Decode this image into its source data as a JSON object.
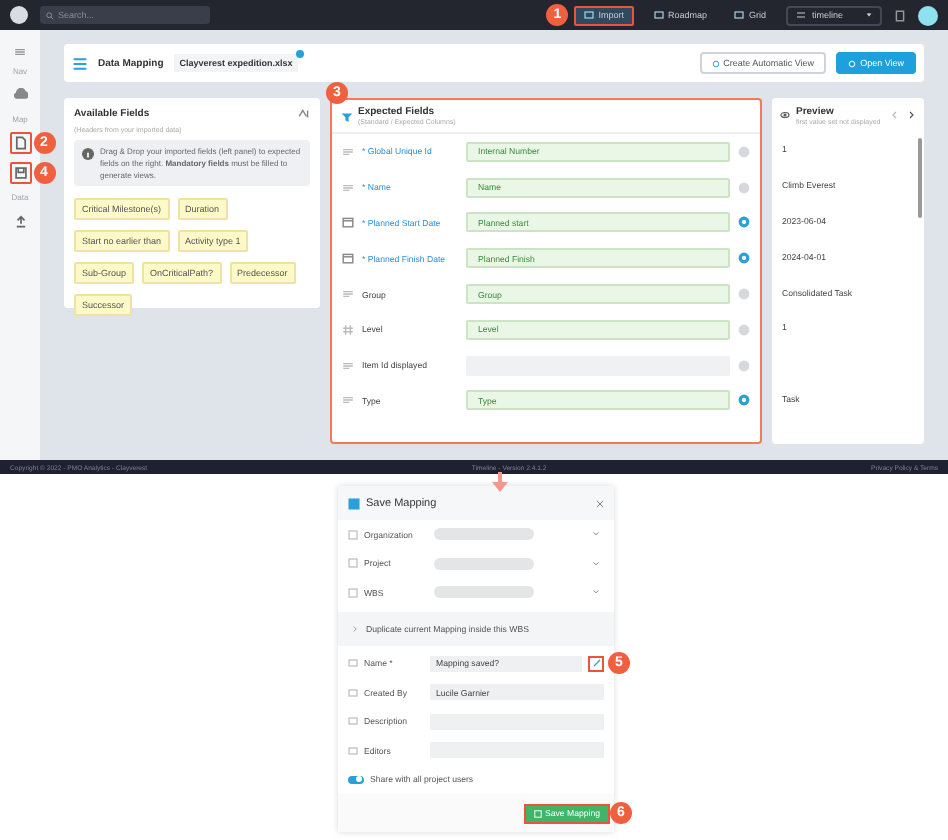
{
  "topbar": {
    "search_placeholder": "Search...",
    "nav": [
      {
        "label": "Import",
        "selected": true,
        "badge": "1"
      },
      {
        "label": "Roadmap",
        "selected": false
      },
      {
        "label": "Grid",
        "selected": false
      }
    ],
    "view_select": "timeline"
  },
  "rail": {
    "sections": [
      {
        "label": "Nav",
        "items": [
          {
            "highlighted": false
          }
        ]
      },
      {
        "label": "Map",
        "items": [
          {
            "highlighted": true,
            "badge": "2"
          },
          {
            "highlighted": true,
            "badge": "4"
          }
        ]
      },
      {
        "label": "Data",
        "items": [
          {
            "highlighted": false
          }
        ]
      }
    ]
  },
  "header": {
    "title": "Data Mapping",
    "file": "Clayverest expedition.xlsx",
    "buttons": [
      {
        "label": "Create Automatic View",
        "primary": false
      },
      {
        "label": "Open View",
        "primary": true
      }
    ]
  },
  "available": {
    "title": "Available Fields",
    "subtitle": "(Headers from your imported data)",
    "info": "Drag & Drop your imported fields (left panel) to expected fields on the right. **Mandatory fields** must be filled to generate views.",
    "chips": [
      "Critical Milestone(s)",
      "Duration",
      "Start no earlier than",
      "Activity type 1",
      "Sub-Group",
      "OnCriticalPath?",
      "Predecessor",
      "Successor"
    ]
  },
  "expected": {
    "title": "Expected Fields",
    "subtitle": "(Standard / Expected Columns)",
    "badge": "3",
    "rows": [
      {
        "kind": "text",
        "label": "* Global Unique Id",
        "required": true,
        "mapped": "Internal Number",
        "configured": false,
        "preview": "1"
      },
      {
        "kind": "text",
        "label": "* Name",
        "required": true,
        "mapped": "Name",
        "configured": false,
        "preview": "Climb Everest"
      },
      {
        "kind": "date",
        "label": "* Planned Start Date",
        "required": true,
        "mapped": "Planned start",
        "configured": true,
        "preview": "2023-06-04"
      },
      {
        "kind": "date",
        "label": "* Planned Finish Date",
        "required": true,
        "mapped": "Planned Finish",
        "configured": true,
        "preview": "2024-04-01"
      },
      {
        "kind": "text",
        "label": "Group",
        "required": false,
        "mapped": "Group",
        "configured": false,
        "preview": "Consolidated Task"
      },
      {
        "kind": "number",
        "label": "Level",
        "required": false,
        "mapped": "Level",
        "configured": false,
        "preview": "1"
      },
      {
        "kind": "text",
        "label": "Item Id displayed",
        "required": false,
        "configured": false
      },
      {
        "kind": "text",
        "label": "Type",
        "required": false,
        "mapped": "Type",
        "configured": true,
        "preview": "Task"
      }
    ]
  },
  "preview": {
    "title": "Preview",
    "subtitle": "first value set not displayed"
  },
  "footer": {
    "left": "Copyright © 2022 - PMO Analytics - Clayverest",
    "center": "Timeline - Version 2.4.1.2",
    "right": "Privacy Policy & Terms"
  },
  "dialog": {
    "title": "Save Mapping",
    "selects": [
      {
        "label": "Organization"
      },
      {
        "label": "Project"
      },
      {
        "label": "WBS"
      }
    ],
    "section": "Duplicate current Mapping inside this WBS",
    "fields": [
      {
        "label": "Name *",
        "value": "Mapping saved?",
        "editable": true,
        "badge": "5"
      },
      {
        "label": "Created By",
        "value": "Lucile Garnier",
        "editable": false
      },
      {
        "label": "Description",
        "editable": false
      },
      {
        "label": "Editors",
        "editable": false
      }
    ],
    "share": {
      "label": "Share with all project users",
      "on": true
    },
    "save": {
      "label": "Save Mapping",
      "badge": "6"
    }
  }
}
